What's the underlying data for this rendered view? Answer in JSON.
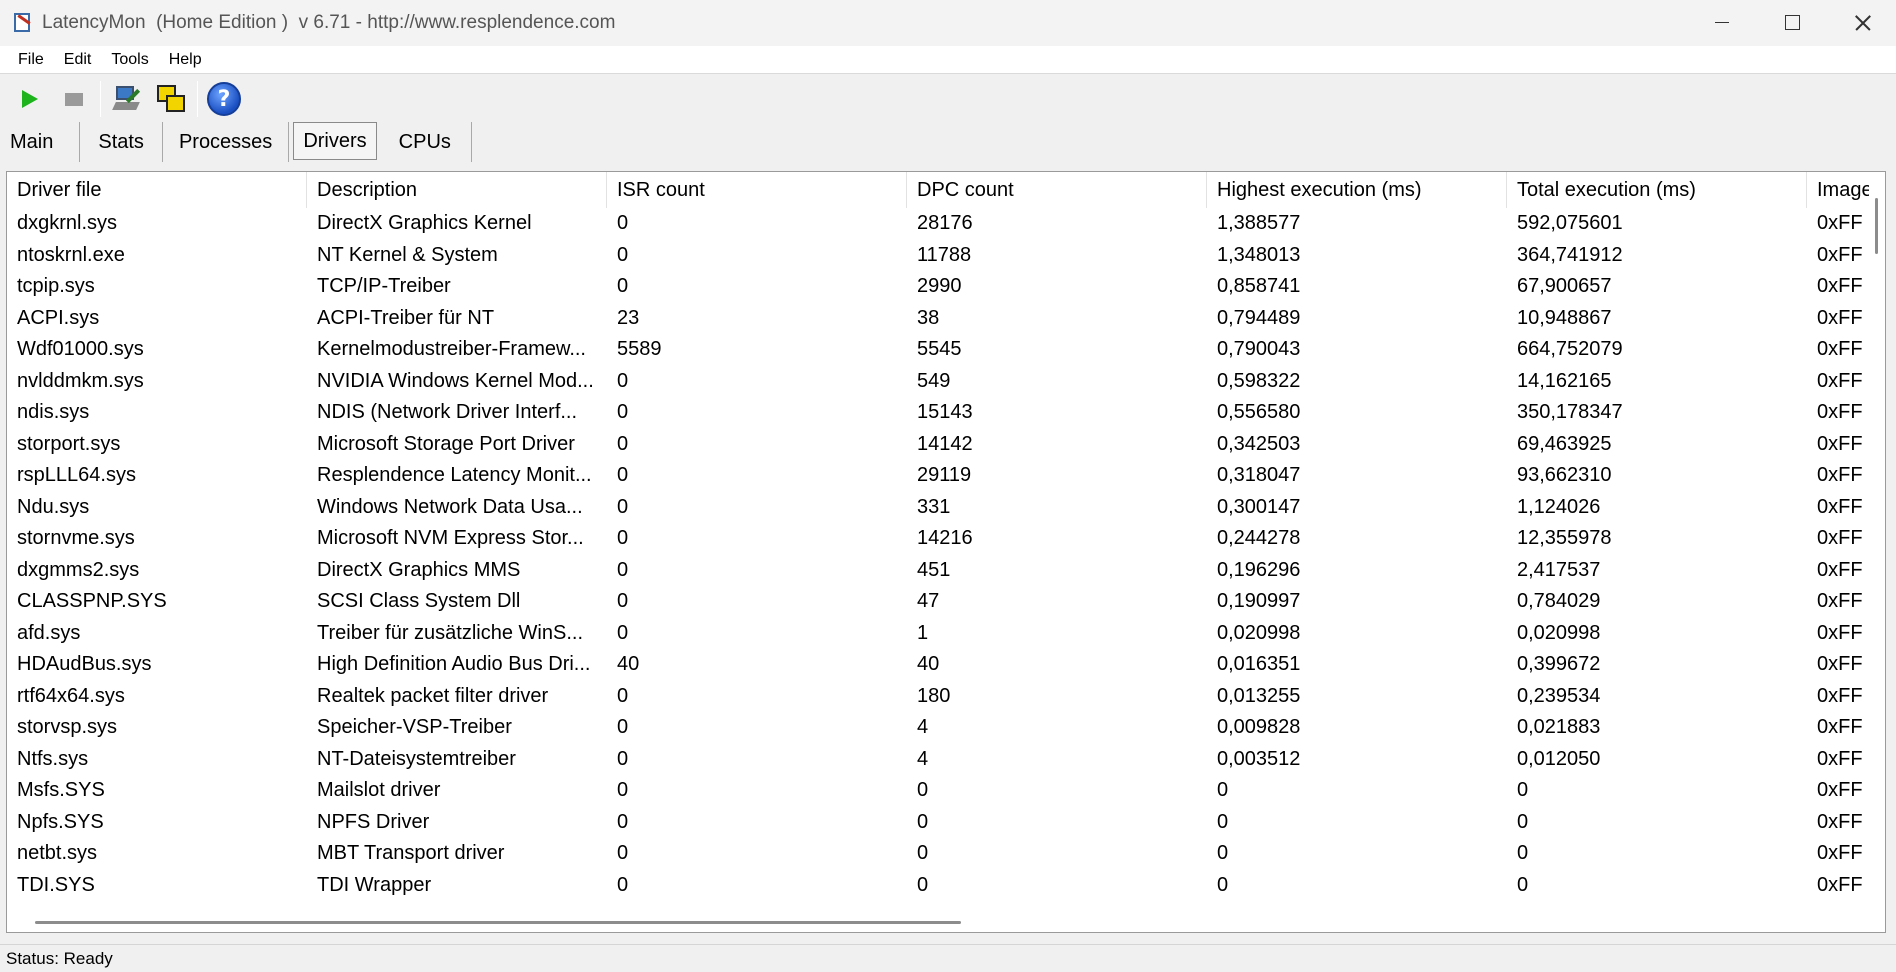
{
  "window": {
    "title": "LatencyMon  (Home Edition )  v 6.71 - http://www.resplendence.com"
  },
  "menu": {
    "items": [
      "File",
      "Edit",
      "Tools",
      "Help"
    ]
  },
  "toolbar": {
    "icons": [
      "play-icon",
      "stop-icon",
      "hardware-icon",
      "windows-icon",
      "help-icon"
    ],
    "help_glyph": "?"
  },
  "tabs": {
    "items": [
      "Main",
      "Stats",
      "Processes",
      "Drivers",
      "CPUs"
    ],
    "active": "Drivers"
  },
  "table": {
    "columns": [
      "Driver file",
      "Description",
      "ISR count",
      "DPC count",
      "Highest execution (ms)",
      "Total execution (ms)",
      "Image"
    ],
    "rows": [
      [
        "dxgkrnl.sys",
        "DirectX Graphics Kernel",
        "0",
        "28176",
        "1,388577",
        "592,075601",
        "0xFF"
      ],
      [
        "ntoskrnl.exe",
        "NT Kernel & System",
        "0",
        "11788",
        "1,348013",
        "364,741912",
        "0xFF"
      ],
      [
        "tcpip.sys",
        "TCP/IP-Treiber",
        "0",
        "2990",
        "0,858741",
        "67,900657",
        "0xFF"
      ],
      [
        "ACPI.sys",
        "ACPI-Treiber für NT",
        "23",
        "38",
        "0,794489",
        "10,948867",
        "0xFF"
      ],
      [
        "Wdf01000.sys",
        "Kernelmodustreiber-Framew...",
        "5589",
        "5545",
        "0,790043",
        "664,752079",
        "0xFF"
      ],
      [
        "nvlddmkm.sys",
        "NVIDIA Windows Kernel Mod...",
        "0",
        "549",
        "0,598322",
        "14,162165",
        "0xFF"
      ],
      [
        "ndis.sys",
        "NDIS (Network Driver Interf...",
        "0",
        "15143",
        "0,556580",
        "350,178347",
        "0xFF"
      ],
      [
        "storport.sys",
        "Microsoft Storage Port Driver",
        "0",
        "14142",
        "0,342503",
        "69,463925",
        "0xFF"
      ],
      [
        "rspLLL64.sys",
        "Resplendence Latency Monit...",
        "0",
        "29119",
        "0,318047",
        "93,662310",
        "0xFF"
      ],
      [
        "Ndu.sys",
        "Windows Network Data Usa...",
        "0",
        "331",
        "0,300147",
        "1,124026",
        "0xFF"
      ],
      [
        "stornvme.sys",
        "Microsoft NVM Express Stor...",
        "0",
        "14216",
        "0,244278",
        "12,355978",
        "0xFF"
      ],
      [
        "dxgmms2.sys",
        "DirectX Graphics MMS",
        "0",
        "451",
        "0,196296",
        "2,417537",
        "0xFF"
      ],
      [
        "CLASSPNP.SYS",
        "SCSI Class System Dll",
        "0",
        "47",
        "0,190997",
        "0,784029",
        "0xFF"
      ],
      [
        "afd.sys",
        "Treiber für zusätzliche WinS...",
        "0",
        "1",
        "0,020998",
        "0,020998",
        "0xFF"
      ],
      [
        "HDAudBus.sys",
        "High Definition Audio Bus Dri...",
        "40",
        "40",
        "0,016351",
        "0,399672",
        "0xFF"
      ],
      [
        "rtf64x64.sys",
        "Realtek packet filter driver",
        "0",
        "180",
        "0,013255",
        "0,239534",
        "0xFF"
      ],
      [
        "storvsp.sys",
        "Speicher-VSP-Treiber",
        "0",
        "4",
        "0,009828",
        "0,021883",
        "0xFF"
      ],
      [
        "Ntfs.sys",
        "NT-Dateisystemtreiber",
        "0",
        "4",
        "0,003512",
        "0,012050",
        "0xFF"
      ],
      [
        "Msfs.SYS",
        "Mailslot driver",
        "0",
        "0",
        "0",
        "0",
        "0xFF"
      ],
      [
        "Npfs.SYS",
        "NPFS Driver",
        "0",
        "0",
        "0",
        "0",
        "0xFF"
      ],
      [
        "netbt.sys",
        "MBT Transport driver",
        "0",
        "0",
        "0",
        "0",
        "0xFF"
      ],
      [
        "TDI.SYS",
        "TDI Wrapper",
        "0",
        "0",
        "0",
        "0",
        "0xFF"
      ]
    ]
  },
  "status": {
    "text": "Status: Ready"
  }
}
